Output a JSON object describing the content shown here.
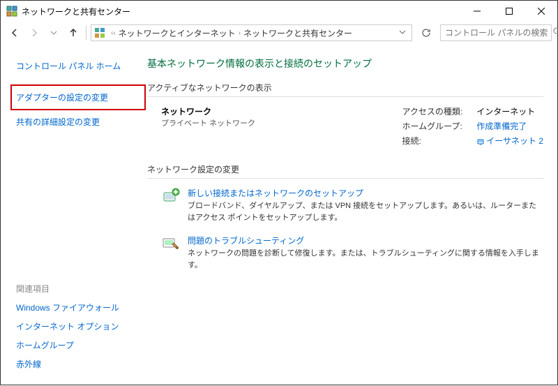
{
  "window": {
    "title": "ネットワークと共有センター"
  },
  "breadcrumb": {
    "item1": "ネットワークとインターネット",
    "item2": "ネットワークと共有センター"
  },
  "search": {
    "placeholder": "コントロール パネルの検索"
  },
  "sidebar": {
    "home": "コントロール パネル ホーム",
    "adapter": "アダプターの設定の変更",
    "sharing": "共有の詳細設定の変更",
    "related_title": "関連項目",
    "firewall": "Windows ファイアウォール",
    "inet_options": "インターネット オプション",
    "homegroup": "ホームグループ",
    "infrared": "赤外線"
  },
  "main": {
    "heading": "基本ネットワーク情報の表示と接続のセットアップ",
    "active_title": "アクティブなネットワークの表示",
    "net_name": "ネットワーク",
    "net_type": "プライベート ネットワーク",
    "access_label": "アクセスの種類:",
    "access_value": "インターネット",
    "homegroup_label": "ホームグループ:",
    "homegroup_value": "作成準備完了",
    "conn_label": "接続:",
    "conn_value": "イーサネット 2",
    "settings_title": "ネットワーク設定の変更",
    "setup_link": "新しい接続またはネットワークのセットアップ",
    "setup_desc": "ブロードバンド、ダイヤルアップ、または VPN 接続をセットアップします。あるいは、ルーターまたはアクセス ポイントをセットアップします。",
    "troubleshoot_link": "問題のトラブルシューティング",
    "troubleshoot_desc": "ネットワークの問題を診断して修復します。または、トラブルシューティングに関する情報を入手します。"
  }
}
